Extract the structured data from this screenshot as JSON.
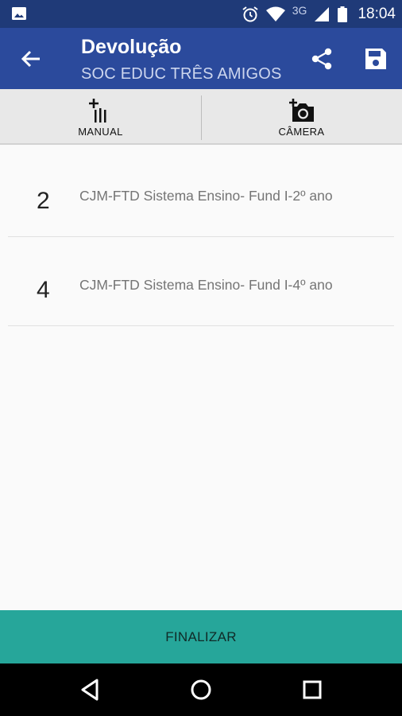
{
  "status_bar": {
    "time": "18:04",
    "network": "3G",
    "icons": [
      "gallery-icon",
      "alarm-icon",
      "wifi-icon",
      "signal-icon",
      "battery-icon"
    ]
  },
  "app_bar": {
    "title": "Devolução",
    "subtitle": "SOC EDUC TRÊS AMIGOS",
    "color": "#2b4a9c",
    "actions": [
      "share-icon",
      "save-icon"
    ]
  },
  "tabs": [
    {
      "label": "MANUAL",
      "icon": "manual-add-icon"
    },
    {
      "label": "CÂMERA",
      "icon": "camera-add-icon"
    }
  ],
  "items": [
    {
      "qty": "2",
      "desc": "CJM-FTD Sistema Ensino- Fund I-2º ano"
    },
    {
      "qty": "4",
      "desc": "CJM-FTD Sistema Ensino- Fund I-4º ano"
    }
  ],
  "finalize": {
    "label": "FINALIZAR",
    "color": "#26a69a"
  },
  "nav_bar": {
    "buttons": [
      "back-nav-icon",
      "home-nav-icon",
      "recents-nav-icon"
    ]
  }
}
